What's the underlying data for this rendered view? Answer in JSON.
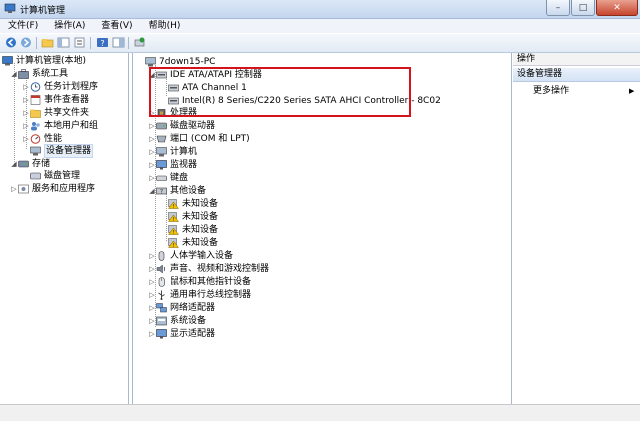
{
  "window": {
    "title": "计算机管理"
  },
  "window_controls": {
    "minimize": "–",
    "maximize": "□",
    "close": "✕"
  },
  "menubar": {
    "items": [
      "文件(F)",
      "操作(A)",
      "查看(V)",
      "帮助(H)"
    ]
  },
  "toolbar": {
    "icons": [
      "back-icon",
      "forward-icon",
      "up-folder-icon",
      "show-hide-tree-icon",
      "properties-icon",
      "help-icon",
      "show-pane-icon",
      "update-driver-icon"
    ]
  },
  "left_tree": {
    "root": "计算机管理(本地)",
    "system_tools": "系统工具",
    "task_scheduler": "任务计划程序",
    "event_viewer": "事件查看器",
    "shared_folders": "共享文件夹",
    "local_users": "本地用户和组",
    "performance": "性能",
    "device_manager": "设备管理器",
    "storage": "存储",
    "disk_management": "磁盘管理",
    "services_apps": "服务和应用程序"
  },
  "device_tree": {
    "root": "7down15-PC",
    "ide_category": "IDE ATA/ATAPI 控制器",
    "ata_channel": "ATA Channel 1",
    "sata_controller": "Intel(R) 8 Series/C220 Series SATA AHCI Controller - 8C02",
    "processor": "处理器",
    "disk_drives": "磁盘驱动器",
    "ports": "端口 (COM 和 LPT)",
    "computer": "计算机",
    "monitors": "监视器",
    "keyboards": "键盘",
    "other_devices": "其他设备",
    "unknown_devices": [
      "未知设备",
      "未知设备",
      "未知设备",
      "未知设备"
    ],
    "hid": "人体学输入设备",
    "sound": "声音、视频和游戏控制器",
    "mice": "鼠标和其他指针设备",
    "usb": "通用串行总线控制器",
    "network": "网络适配器",
    "system_devices": "系统设备",
    "display": "显示适配器"
  },
  "actions": {
    "header": "操作",
    "section": "设备管理器",
    "more": "更多操作"
  },
  "colors": {
    "highlight_box": "#d3141c",
    "warning": "#f2c200"
  }
}
